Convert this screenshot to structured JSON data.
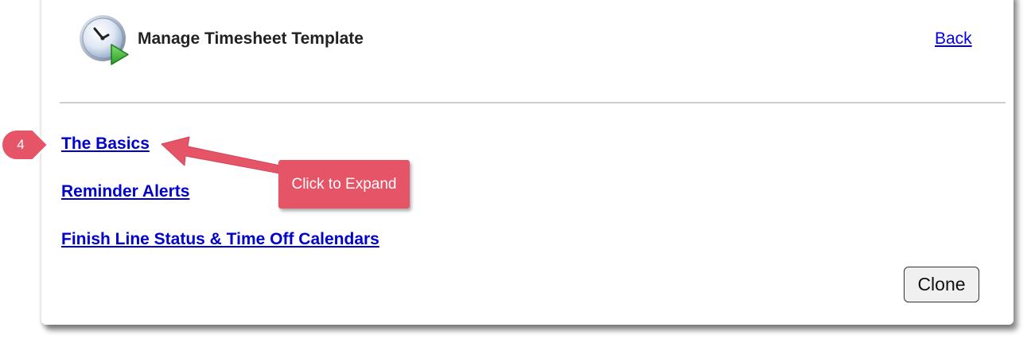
{
  "header": {
    "icon": "clock-play-icon",
    "title": "Manage Timesheet Template",
    "back_label": "Back"
  },
  "sections": [
    {
      "label": "The Basics"
    },
    {
      "label": "Reminder Alerts"
    },
    {
      "label": "Finish Line Status & Time Off Calendars"
    }
  ],
  "actions": {
    "clone_label": "Clone"
  },
  "annotation": {
    "step_number": "4",
    "callout_text": "Click to Expand",
    "color": "#e65468"
  },
  "colors": {
    "link": "#0000cc",
    "divider": "#cfcfcf"
  }
}
